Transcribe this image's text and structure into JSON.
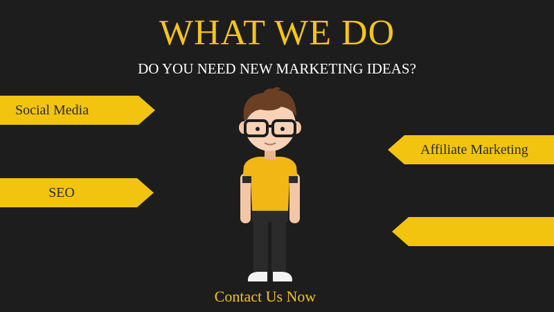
{
  "header": {
    "title": "WHAT WE DO",
    "subtitle": "DO YOU NEED NEW MARKETING IDEAS?"
  },
  "services": {
    "left": [
      "Social Media",
      "SEO"
    ],
    "right": [
      "Affiliate Marketing",
      ""
    ]
  },
  "cta": {
    "label": "Contact Us Now"
  },
  "colors": {
    "background": "#1d1d1d",
    "accent": "#f2c40f",
    "title": "#f5c518"
  },
  "illustration": {
    "icon": "person-with-glasses-icon"
  }
}
